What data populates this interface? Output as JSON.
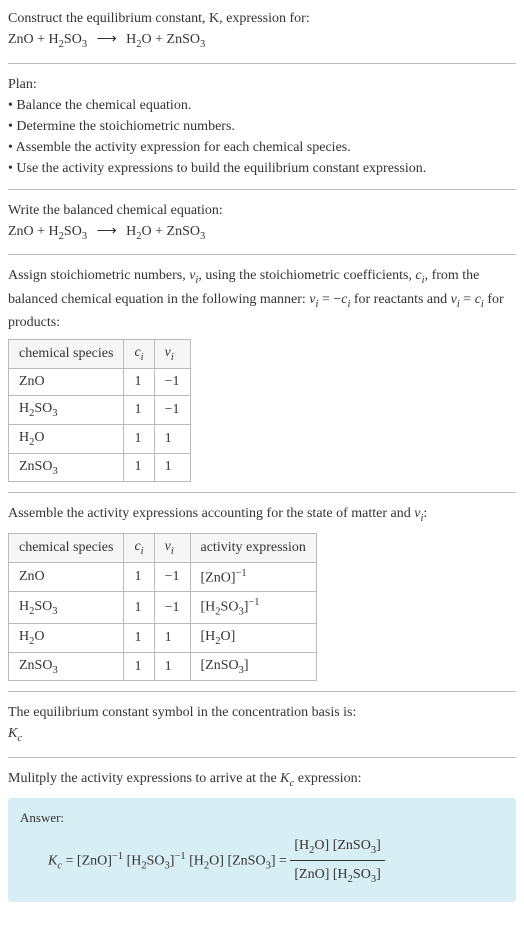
{
  "q_title": "Construct the equilibrium constant, K, expression for:",
  "eq_main_lhs1": "ZnO + H",
  "eq_main_lhs2": "2",
  "eq_main_lhs3": "SO",
  "eq_main_lhs4": "3",
  "eq_main_arrow": "⟶",
  "eq_main_rhs1": "H",
  "eq_main_rhs2": "2",
  "eq_main_rhs3": "O + ZnSO",
  "eq_main_rhs4": "3",
  "plan_h": "Plan:",
  "plan1": "• Balance the chemical equation.",
  "plan2": "• Determine the stoichiometric numbers.",
  "plan3": "• Assemble the activity expression for each chemical species.",
  "plan4": "• Use the activity expressions to build the equilibrium constant expression.",
  "bal_h": "Write the balanced chemical equation:",
  "stoich_p1": "Assign stoichiometric numbers, ",
  "stoich_p2": ", using the stoichiometric coefficients, ",
  "stoich_p3": ", from the balanced chemical equation in the following manner: ",
  "stoich_p4": " for reactants and ",
  "stoich_p5": " for products:",
  "nu_i": "ν",
  "i_sub": "i",
  "c_i": "c",
  "eqn_nu_neg": " = −",
  "eqn_nu_pos": " = ",
  "th_species": "chemical species",
  "th_c": "c",
  "th_nu": "ν",
  "th_activity": "activity expression",
  "sp": {
    "zno": "ZnO",
    "h2so3_a": "H",
    "h2so3_b": "2",
    "h2so3_c": "SO",
    "h2so3_d": "3",
    "h2o_a": "H",
    "h2o_b": "2",
    "h2o_c": "O",
    "znso3_a": "ZnSO",
    "znso3_b": "3"
  },
  "t1": {
    "zno_c": "1",
    "zno_n": "−1",
    "h2so3_c": "1",
    "h2so3_n": "−1",
    "h2o_c": "1",
    "h2o_n": "1",
    "znso3_c": "1",
    "znso3_n": "1"
  },
  "act_h": "Assemble the activity expressions accounting for the state of matter and ",
  "act_h2": ":",
  "act": {
    "zno": "[ZnO]",
    "neg1": "−1",
    "h2so3": "[H",
    "h2so3b": "SO",
    "close": "]",
    "h2o": "[H",
    "h2ob": "O]",
    "znso3": "[ZnSO",
    "znso3b": "]"
  },
  "kc_h1": "The equilibrium constant symbol in the concentration basis is:",
  "kc_sym": "K",
  "kc_sub": "c",
  "mult_h1": "Mulitply the activity expressions to arrive at the ",
  "mult_h2": " expression:",
  "ans_label": "Answer:",
  "ans": {
    "eq": " = ",
    "sp": " "
  }
}
